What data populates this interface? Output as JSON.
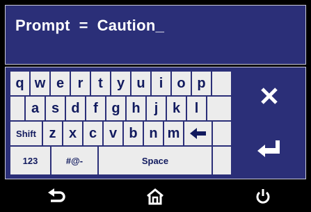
{
  "prompt": {
    "text": "Prompt  =  Caution_"
  },
  "keyboard": {
    "row1": [
      "q",
      "w",
      "e",
      "r",
      "t",
      "y",
      "u",
      "i",
      "o",
      "p"
    ],
    "row2": [
      "a",
      "s",
      "d",
      "f",
      "g",
      "h",
      "j",
      "k",
      "l"
    ],
    "row3": {
      "shift": "Shift",
      "letters": [
        "z",
        "x",
        "c",
        "v",
        "b",
        "n",
        "m"
      ]
    },
    "row4": {
      "numbers": "123",
      "symbols": "#@-",
      "space": "Space"
    }
  },
  "icons": {
    "backspace": "backspace-arrow-icon",
    "close": "close-x-icon",
    "enter": "enter-return-icon",
    "back": "back-arrow-icon",
    "home": "home-icon",
    "power": "power-icon"
  },
  "colors": {
    "panel": "#2b2f78",
    "key": "#ececec",
    "keyText": "#111a5e"
  }
}
